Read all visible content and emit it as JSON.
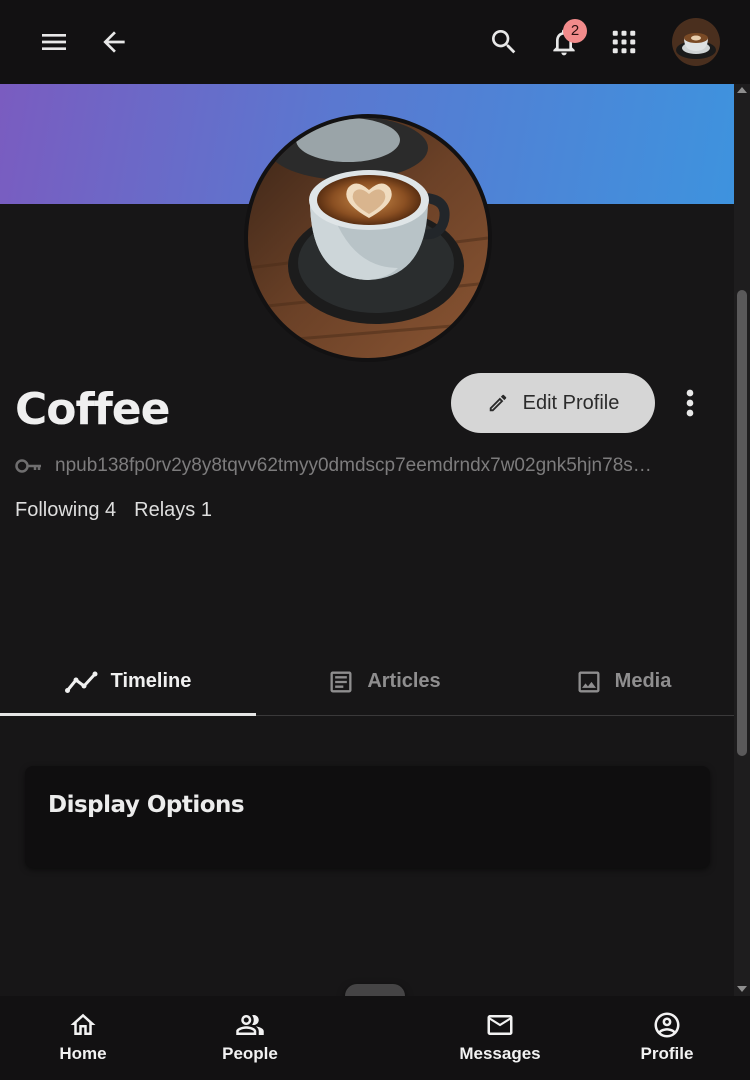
{
  "topbar": {
    "notification_count": "2"
  },
  "profile": {
    "name": "Coffee",
    "edit_label": "Edit Profile",
    "npub": "npub138fp0rv2y8y8tqvv62tmyy0dmdscp7eemdrndx7w02gnk5hjn78s…",
    "following": "Following 4",
    "relays": "Relays 1"
  },
  "tabs": [
    {
      "label": "Timeline",
      "icon": "timeline-icon"
    },
    {
      "label": "Articles",
      "icon": "article-icon"
    },
    {
      "label": "Media",
      "icon": "image-icon"
    }
  ],
  "card": {
    "title": "Display Options"
  },
  "bottom_nav": [
    {
      "label": "Home",
      "icon": "home-icon"
    },
    {
      "label": "People",
      "icon": "people-icon"
    },
    {
      "label": "Messages",
      "icon": "mail-icon"
    },
    {
      "label": "Profile",
      "icon": "account-circle-icon"
    }
  ],
  "colors": {
    "banner_start": "#7a5cc0",
    "banner_end": "#3e93de",
    "badge": "#f28b8b",
    "background": "#171617"
  }
}
